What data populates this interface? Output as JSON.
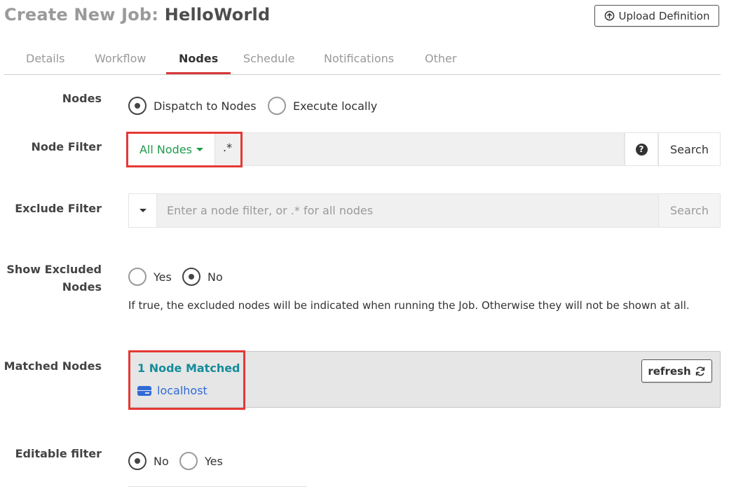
{
  "header": {
    "title_prefix": "Create New Job:",
    "job_name": "HelloWorld",
    "upload_label": "Upload Definition"
  },
  "tabs": [
    {
      "label": "Details"
    },
    {
      "label": "Workflow"
    },
    {
      "label": "Nodes",
      "active": true
    },
    {
      "label": "Schedule"
    },
    {
      "label": "Notifications"
    },
    {
      "label": "Other"
    }
  ],
  "nodes": {
    "label": "Nodes",
    "options": [
      "Dispatch to Nodes",
      "Execute locally"
    ],
    "selected": "Dispatch to Nodes"
  },
  "node_filter": {
    "label": "Node Filter",
    "dropdown_label": "All Nodes",
    "value": ".*",
    "search_label": "Search"
  },
  "exclude_filter": {
    "label": "Exclude Filter",
    "placeholder": "Enter a node filter, or .* for all nodes",
    "search_label": "Search"
  },
  "show_excluded": {
    "label_line1": "Show Excluded",
    "label_line2": "Nodes",
    "options": [
      "Yes",
      "No"
    ],
    "selected": "No",
    "help": "If true, the excluded nodes will be indicated when running the Job. Otherwise they will not be shown at all."
  },
  "matched_nodes": {
    "label": "Matched Nodes",
    "count_text": "1 Node Matched",
    "nodes": [
      "localhost"
    ],
    "refresh_label": "refresh"
  },
  "editable_filter": {
    "label": "Editable filter",
    "options": [
      "No",
      "Yes"
    ],
    "selected": "No"
  },
  "colors": {
    "active_tab_underline": "#d9383a",
    "highlight_box": "#e53935",
    "node_filter_green": "#1e9a4a",
    "matched_teal": "#158c9a",
    "link_blue": "#2f6ad6"
  }
}
